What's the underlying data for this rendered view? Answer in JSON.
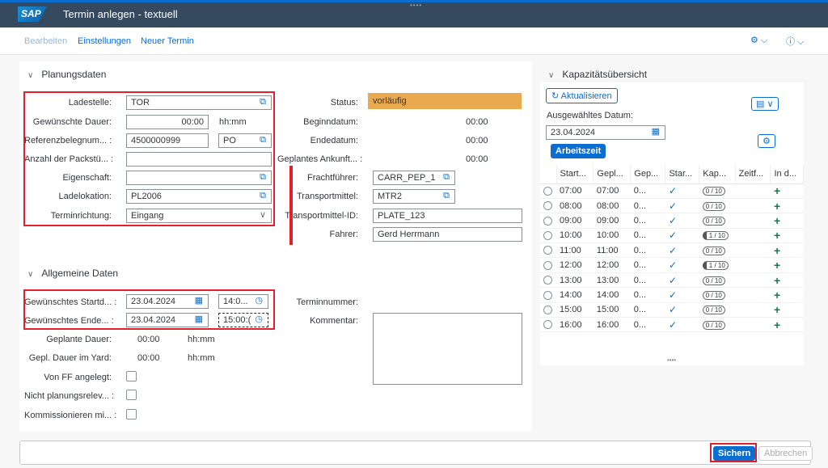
{
  "shell": {
    "logo": "SAP",
    "title": "Termin anlegen - textuell"
  },
  "toolbar": {
    "edit": "Bearbeiten",
    "settings": "Einstellungen",
    "new": "Neuer Termin"
  },
  "planning": {
    "title": "Planungsdaten",
    "ladestelle_label": "Ladestelle:",
    "ladestelle": "TOR",
    "dauer_label": "Gewünschte Dauer:",
    "dauer": "00:00",
    "dauer_unit": "hh:mm",
    "ref_label": "Referenzbelegnum... :",
    "ref": "4500000999",
    "ref_type": "PO",
    "packs_label": "Anzahl der Packstü... :",
    "packs": "",
    "eigenschaft_label": "Eigenschaft:",
    "eigenschaft": "",
    "ladelok_label": "Ladelokation:",
    "ladelok": "PL2006",
    "richtung_label": "Terminrichtung:",
    "richtung": "Eingang",
    "status_label": "Status:",
    "status": "vorläufig",
    "beginn_label": "Beginndatum:",
    "beginn": "00:00",
    "ende_label": "Endedatum:",
    "ende": "00:00",
    "ankunft_label": "Geplantes Ankunft... :",
    "ankunft": "00:00",
    "fracht_label": "Frachtführer:",
    "fracht": "CARR_PEP_1",
    "tm_label": "Transportmittel:",
    "tm": "MTR2",
    "tmid_label": "Transportmittel-ID:",
    "tmid": "PLATE_123",
    "fahrer_label": "Fahrer:",
    "fahrer": "Gerd Herrmann"
  },
  "general": {
    "title": "Allgemeine Daten",
    "start_label": "Gewünschtes Startd... :",
    "start_date": "23.04.2024",
    "start_time": "14:0...",
    "end_label": "Gewünschtes Ende... :",
    "end_date": "23.04.2024",
    "end_time": "15:00:(",
    "gdauer_label": "Geplante Dauer:",
    "gdauer": "00:00",
    "gdauer_unit": "hh:mm",
    "yard_label": "Gepl. Dauer im Yard:",
    "yard": "00:00",
    "yard_unit": "hh:mm",
    "ff_label": "Von FF angelegt:",
    "nicht_label": "Nicht planungsrelev... :",
    "komm_label": "Kommissionieren mi... :",
    "terminnr_label": "Terminnummer:",
    "kommentar_label": "Kommentar:"
  },
  "capacity": {
    "title": "Kapazitätsübersicht",
    "refresh": "Aktualisieren",
    "date_label": "Ausgewähltes Datum:",
    "date": "23.04.2024",
    "worktime": "Arbeitszeit",
    "headers": [
      "Start...",
      "Gepl...",
      "Gep...",
      "Star...",
      "Kap...",
      "Zeitf...",
      "In d..."
    ],
    "rows": [
      {
        "start": "07:00",
        "gepl": "07:00",
        "gep": "0...",
        "kap": "0 / 10",
        "part": false
      },
      {
        "start": "08:00",
        "gepl": "08:00",
        "gep": "0...",
        "kap": "0 / 10",
        "part": false
      },
      {
        "start": "09:00",
        "gepl": "09:00",
        "gep": "0...",
        "kap": "0 / 10",
        "part": false
      },
      {
        "start": "10:00",
        "gepl": "10:00",
        "gep": "0...",
        "kap": "1 / 10",
        "part": true
      },
      {
        "start": "11:00",
        "gepl": "11:00",
        "gep": "0...",
        "kap": "0 / 10",
        "part": false
      },
      {
        "start": "12:00",
        "gepl": "12:00",
        "gep": "0...",
        "kap": "1 / 10",
        "part": true
      },
      {
        "start": "13:00",
        "gepl": "13:00",
        "gep": "0...",
        "kap": "0 / 10",
        "part": false
      },
      {
        "start": "14:00",
        "gepl": "14:00",
        "gep": "0...",
        "kap": "0 / 10",
        "part": false
      },
      {
        "start": "15:00",
        "gepl": "15:00",
        "gep": "0...",
        "kap": "0 / 10",
        "part": false
      },
      {
        "start": "16:00",
        "gepl": "16:00",
        "gep": "0...",
        "kap": "0 / 10",
        "part": false
      }
    ]
  },
  "footer": {
    "save": "Sichern",
    "cancel": "Abbrechen"
  }
}
